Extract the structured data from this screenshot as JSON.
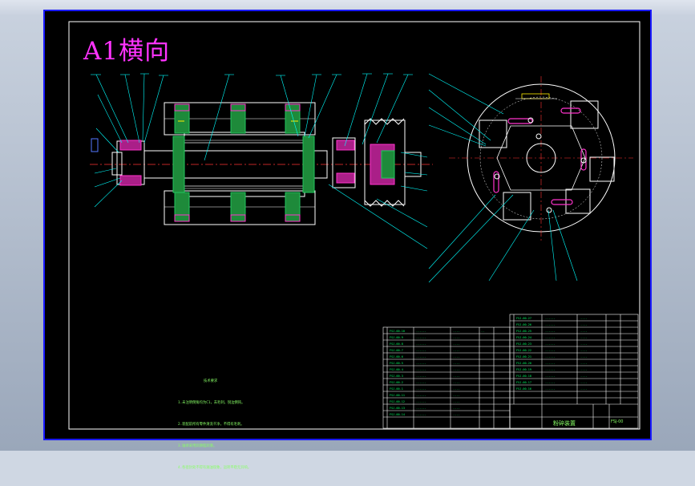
{
  "drawing": {
    "sheet_label": "A1横向",
    "tech_notes": {
      "title": "技术要求",
      "lines": [
        "1.未注明倒角均为C1，去毛刺，锐边倒钝。",
        "2.装配前所有零件清洗干净，不得有毛刺。",
        "3.轴承采用润滑脂润滑。",
        "4.各密封处不得有漏油现象，运转平稳无异响。"
      ]
    },
    "title_block": {
      "name": "粉碎装置",
      "code": "FSJ-00"
    },
    "colors": {
      "background": "#000000",
      "border": "#1a1aff",
      "outline": "#ffffff",
      "leader": "#00ffff",
      "hatch_green": "#22c55e",
      "hatch_magenta": "#ff33cc",
      "centerline": "#ff3333",
      "table_text": "#00ff66",
      "label_magenta": "#ff33ff"
    }
  }
}
